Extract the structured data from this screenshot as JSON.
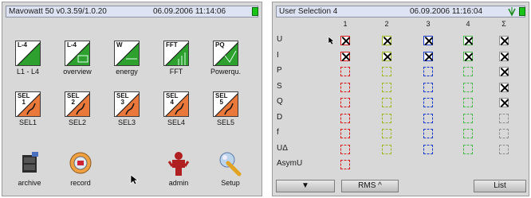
{
  "left_screen": {
    "status": {
      "title": "Mavowatt 50 v0.3.59/1.0.20",
      "datetime": "06.09.2006 11:14:06"
    },
    "tiles": [
      {
        "label": "L1 - L4",
        "icon_text": "L-4",
        "icon": "l1-l4-icon"
      },
      {
        "label": "overview",
        "icon_text": "L-4",
        "icon": "overview-icon"
      },
      {
        "label": "energy",
        "icon_text": "W",
        "icon": "energy-icon"
      },
      {
        "label": "FFT",
        "icon_text": "FFT",
        "icon": "fft-icon"
      },
      {
        "label": "Powerqu.",
        "icon_text": "PQ",
        "icon": "powerquality-icon"
      },
      {
        "label": "SEL1",
        "icon_text": "SEL\n1",
        "icon": "sel1-icon"
      },
      {
        "label": "SEL2",
        "icon_text": "SEL\n2",
        "icon": "sel2-icon"
      },
      {
        "label": "SEL3",
        "icon_text": "SEL\n3",
        "icon": "sel3-icon"
      },
      {
        "label": "SEL4",
        "icon_text": "SEL\n4",
        "icon": "sel4-icon"
      },
      {
        "label": "SEL5",
        "icon_text": "SEL\n5",
        "icon": "sel5-icon"
      },
      {
        "label": "archive",
        "icon": "archive-icon"
      },
      {
        "label": "record",
        "icon": "record-icon"
      },
      {
        "label": "admin",
        "icon": "admin-icon"
      },
      {
        "label": "Setup",
        "icon": "setup-wrench-icon"
      }
    ]
  },
  "right_screen": {
    "status": {
      "title": "User Selection 4",
      "datetime": "06.09.2006 11:16:04"
    },
    "columns": [
      "1",
      "2",
      "3",
      "4",
      "Σ"
    ],
    "column_colors": [
      "#d81818",
      "#9ab818",
      "#1838c8",
      "#48b848",
      "#909090"
    ],
    "rows": [
      {
        "label": "U",
        "selected": [
          true,
          true,
          true,
          true,
          true
        ]
      },
      {
        "label": "I",
        "selected": [
          true,
          true,
          true,
          true,
          true
        ]
      },
      {
        "label": "P",
        "selected": [
          false,
          false,
          false,
          false,
          true
        ]
      },
      {
        "label": "S",
        "selected": [
          false,
          false,
          false,
          false,
          true
        ]
      },
      {
        "label": "Q",
        "selected": [
          false,
          false,
          false,
          false,
          true
        ]
      },
      {
        "label": "D",
        "selected": [
          false,
          false,
          false,
          false,
          false
        ]
      },
      {
        "label": "f",
        "selected": [
          false,
          false,
          false,
          false,
          false
        ]
      },
      {
        "label": "UΔ",
        "selected": [
          false,
          false,
          false,
          false,
          false
        ]
      },
      {
        "label": "AsymU",
        "selected": [
          false,
          null,
          null,
          null,
          null
        ]
      }
    ],
    "buttons": {
      "down": "▼",
      "rms": "RMS ^",
      "list": "List"
    }
  }
}
